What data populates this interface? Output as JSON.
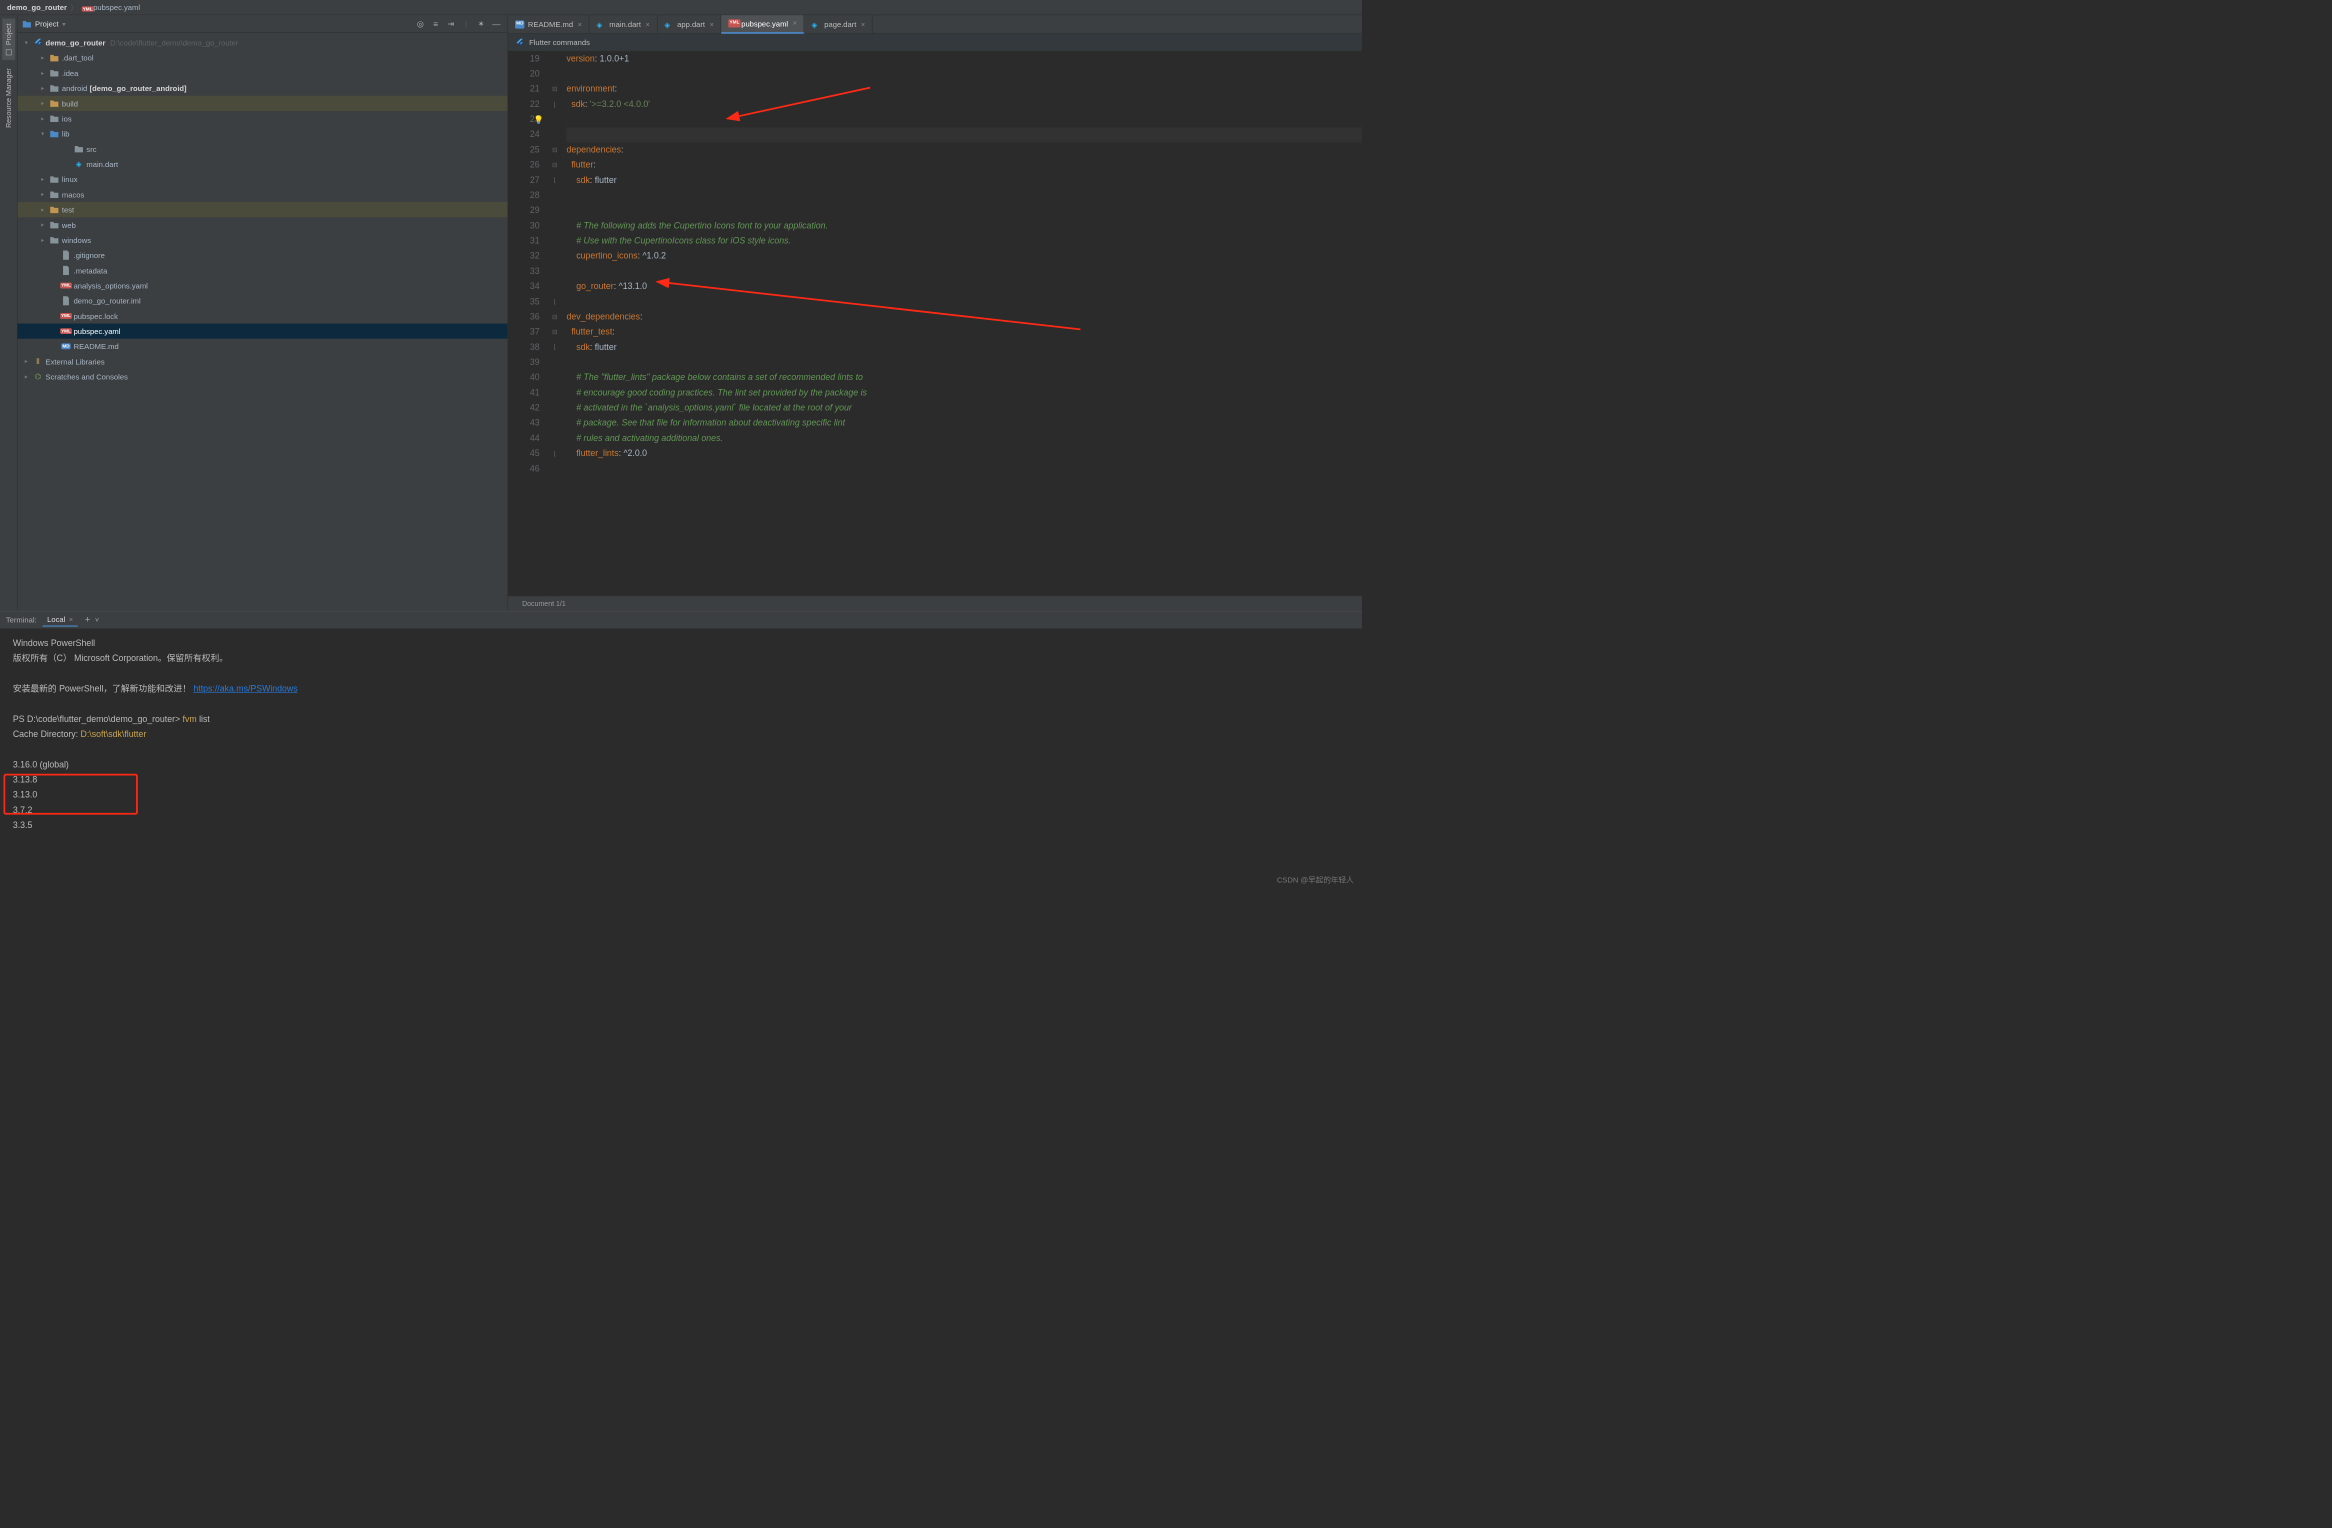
{
  "breadcrumbs": {
    "project": "demo_go_router",
    "file": "pubspec.yaml"
  },
  "rails": {
    "project": "Project",
    "resmgr": "Resource Manager"
  },
  "project_header": {
    "title": "Project"
  },
  "tree": {
    "root_label": "demo_go_router",
    "root_path": "D:\\code\\flutter_demo\\demo_go_router",
    "dart_tool": ".dart_tool",
    "idea": ".idea",
    "android_label": "android",
    "android_suffix": "[demo_go_router_android]",
    "build": "build",
    "ios": "ios",
    "lib": "lib",
    "src": "src",
    "main_dart": "main.dart",
    "linux": "linux",
    "macos": "macos",
    "test": "test",
    "web": "web",
    "windows": "windows",
    "gitignore": ".gitignore",
    "metadata": ".metadata",
    "analysis": "analysis_options.yaml",
    "iml": "demo_go_router.iml",
    "lock": "pubspec.lock",
    "pubspec": "pubspec.yaml",
    "readme": "README.md",
    "external": "External Libraries",
    "scratches": "Scratches and Consoles"
  },
  "tabs": [
    {
      "label": "README.md",
      "icon": "md",
      "active": false
    },
    {
      "label": "main.dart",
      "icon": "dart",
      "active": false
    },
    {
      "label": "app.dart",
      "icon": "dart",
      "active": false
    },
    {
      "label": "pubspec.yaml",
      "icon": "yaml",
      "active": true
    },
    {
      "label": "page.dart",
      "icon": "dart",
      "active": false
    }
  ],
  "flutter_bar": "Flutter commands",
  "editor": {
    "line_numbers": [
      "19",
      "20",
      "21",
      "22",
      "23",
      "24",
      "25",
      "26",
      "27",
      "28",
      "29",
      "30",
      "31",
      "32",
      "33",
      "34",
      "35",
      "36",
      "37",
      "38",
      "39",
      "40",
      "41",
      "42",
      "43",
      "44",
      "45",
      "46"
    ],
    "lines": {
      "l19a": "version",
      "l19b": ": ",
      "l19c": "1.0.0+1",
      "l21a": "environment",
      "l21b": ":",
      "l22a": "  sdk",
      "l22b": ": ",
      "l22c": "'>=3.2.0 <4.0.0'",
      "l25a": "dependencies",
      "l25b": ":",
      "l26a": "  flutter",
      "l26b": ":",
      "l27a": "    sdk",
      "l27b": ": flutter",
      "l30": "    # The following adds the Cupertino Icons font to your application.",
      "l31": "    # Use with the CupertinoIcons class for iOS style icons.",
      "l32a": "    cupertino_icons",
      "l32b": ": ^1.0.2",
      "l34a": "    go_router",
      "l34b": ": ^13.1.0",
      "l36a": "dev_dependencies",
      "l36b": ":",
      "l37a": "  flutter_test",
      "l37b": ":",
      "l38a": "    sdk",
      "l38b": ": flutter",
      "l40": "    # The \"flutter_lints\" package below contains a set of recommended lints to",
      "l41": "    # encourage good coding practices. The lint set provided by the package is",
      "l42": "    # activated in the `analysis_options.yaml` file located at the root of your",
      "l43": "    # package. See that file for information about deactivating specific lint",
      "l44": "    # rules and activating additional ones.",
      "l45a": "    flutter_lints",
      "l45b": ": ^2.0.0"
    }
  },
  "status": {
    "doc": "Document 1/1"
  },
  "terminal": {
    "header": "Terminal:",
    "tab": "Local",
    "lines": {
      "l1": "Windows PowerShell",
      "l2": "版权所有（C） Microsoft Corporation。保留所有权利。",
      "l3a": "安装最新的 PowerShell，了解新功能和改进！",
      "l3b": "https://aka.ms/PSWindows",
      "l4a": "PS D:\\code\\flutter_demo\\demo_go_router> ",
      "l4b": "fvm",
      "l4c": " list",
      "l5a": "Cache Directory:  ",
      "l5b": "D:\\soft\\sdk\\flutter",
      "l6": "3.16.0 (global)",
      "l7": "3.13.8",
      "l8": "3.13.0",
      "l9": "3.7.2",
      "l10": "3.3.5"
    }
  },
  "watermark": "CSDN @早起的年轻人"
}
